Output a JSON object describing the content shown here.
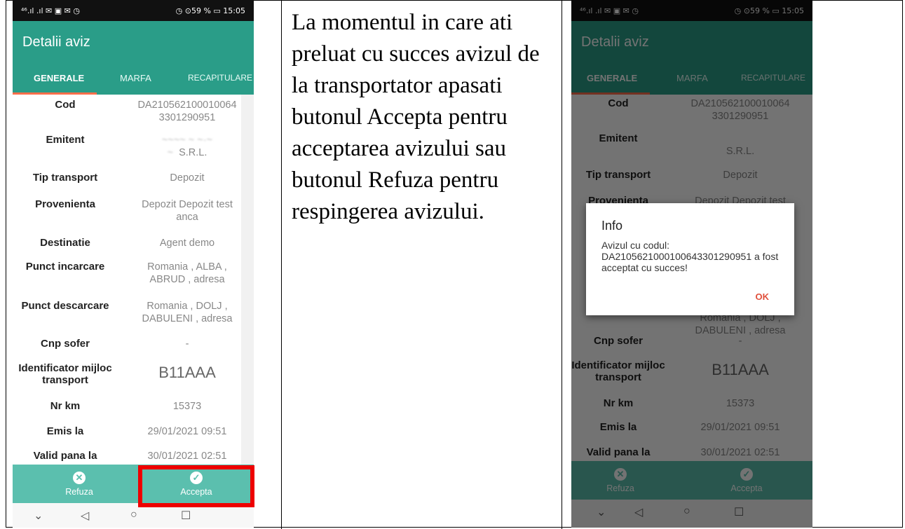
{
  "status_bar": {
    "left": "⁴⁶.ıl .ıl ✉ ▣ ✉ ◷",
    "right": "◷ ⊙59 % ▭ 15:05"
  },
  "app_title": "Detalii aviz",
  "tabs": [
    "GENERALE",
    "MARFA",
    "RECAPITULARE"
  ],
  "details": [
    {
      "label": "Cod",
      "value": "DA210562100010064 3301290951"
    },
    {
      "label": "Emitent",
      "value": "S.R.L."
    },
    {
      "label": "Tip transport",
      "value": "Depozit"
    },
    {
      "label": "Provenienta",
      "value": "Depozit Depozit test anca"
    },
    {
      "label": "Destinatie",
      "value": "Agent demo"
    },
    {
      "label": "Punct incarcare",
      "value": "Romania , ALBA , ABRUD , adresa"
    },
    {
      "label": "Punct descarcare",
      "value": "Romania , DOLJ , DABULENI , adresa"
    },
    {
      "label": "Cnp sofer",
      "value": "-"
    },
    {
      "label": "Identificator mijloc transport",
      "value": "B11AAA"
    },
    {
      "label": "Nr km",
      "value": "15373"
    },
    {
      "label": "Emis la",
      "value": "29/01/2021 09:51"
    },
    {
      "label": "Valid pana la",
      "value": "30/01/2021 02:51"
    }
  ],
  "bottom_actions": {
    "refuse": "Refuza",
    "accept": "Accepta"
  },
  "instruction_text": "La momentul in care ati preluat cu succes avizul de la transportator apasati butonul Accepta pentru acceptarea avizului sau butonul Refuza pentru respingerea avizului.",
  "dialog": {
    "title": "Info",
    "message": "Avizul cu codul: DA210562100010064330129​0951 a fost acceptat cu succes!",
    "ok": "OK"
  },
  "colors": {
    "primary": "#2a9d88",
    "bottom_bar": "#5bbfae",
    "highlight": "#ee0000",
    "tab_indicator": "#ff6e4a",
    "dialog_ok": "#e0503c"
  }
}
